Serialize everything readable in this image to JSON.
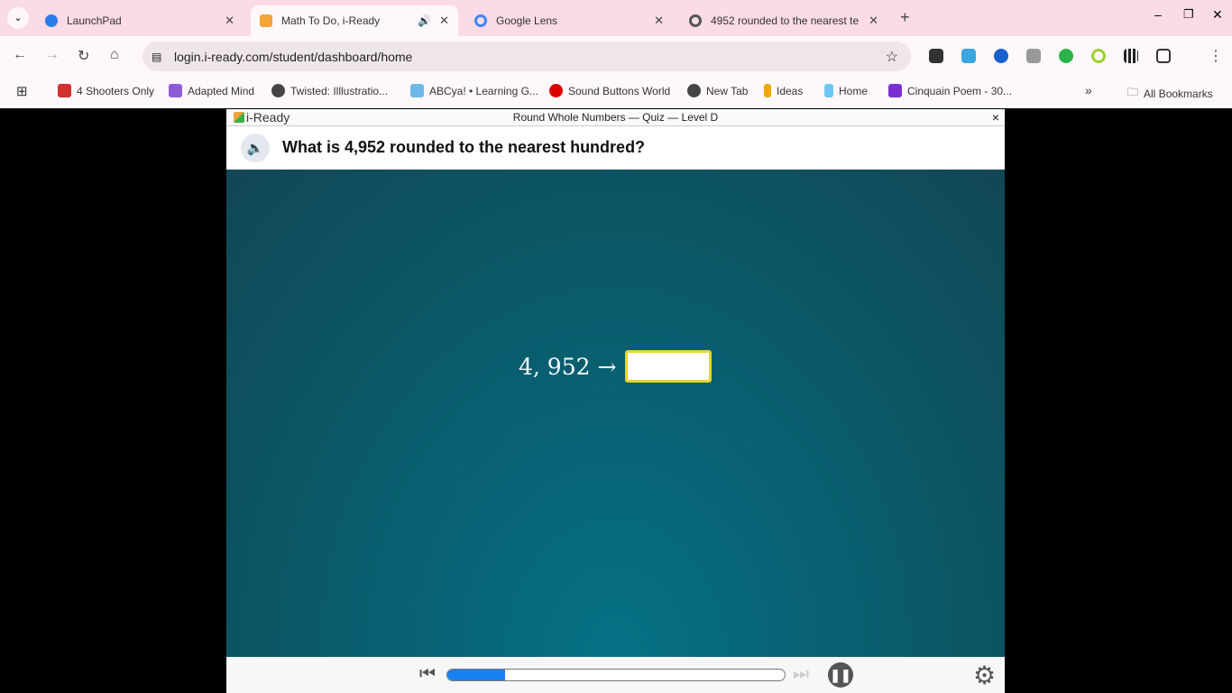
{
  "browser": {
    "tabs": [
      {
        "label": "LaunchPad",
        "color": "#2b7de9"
      },
      {
        "label": "Math To Do, i-Ready",
        "color": "#f2a33a",
        "active": true
      },
      {
        "label": "Google Lens",
        "color": "#4285f4"
      },
      {
        "label": "4952 rounded to the nearest te",
        "color": "#555"
      }
    ],
    "url": "login.i-ready.com/student/dashboard/home",
    "bookmarks": [
      {
        "label": "4 Shooters Only",
        "color": "#d32f2f"
      },
      {
        "label": "Adapted Mind",
        "color": "#8e5bd6"
      },
      {
        "label": "Twisted: Illlustratio...",
        "color": "#444"
      },
      {
        "label": "ABCya! • Learning G...",
        "color": "#6fb7e8"
      },
      {
        "label": "Sound Buttons World",
        "color": "#d00"
      },
      {
        "label": "New Tab",
        "color": "#444"
      },
      {
        "label": "Ideas",
        "color": "#f0a800"
      },
      {
        "label": "Home",
        "color": "#6ec6f0"
      },
      {
        "label": "Cinquain Poem - 30...",
        "color": "#7b2fd1"
      }
    ],
    "all_bookmarks": "All Bookmarks"
  },
  "app": {
    "logo": "i-Ready",
    "title": "Round Whole Numbers — Quiz — Level D",
    "close": "×",
    "question": "What is 4,952 rounded to the nearest hundred?",
    "expression": "4, 952 →",
    "answer": "",
    "answer_border": "#e7d62a",
    "progress_percent": 17
  }
}
